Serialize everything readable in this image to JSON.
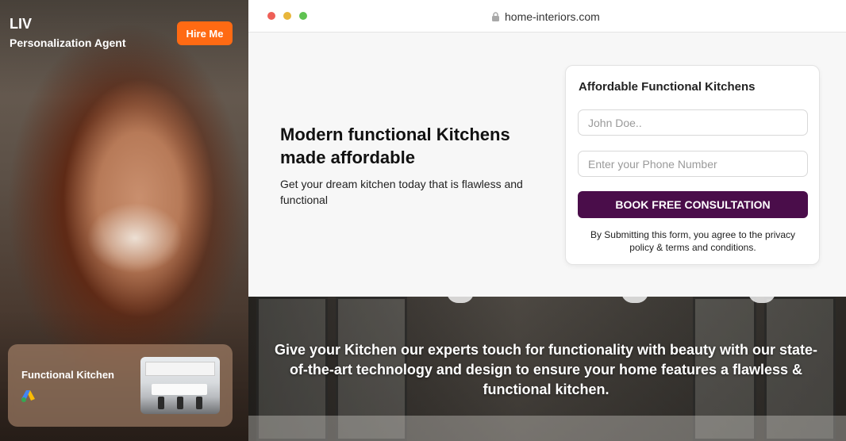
{
  "agent": {
    "name": "LIV",
    "role": "Personalization Agent",
    "hire_label": "Hire Me",
    "ad_card": {
      "title": "Functional Kitchen",
      "icon": "google-ads-icon"
    }
  },
  "browser": {
    "url": "home-interiors.com",
    "lock_icon": "lock-icon"
  },
  "hero": {
    "title": "Modern functional Kitchens made affordable",
    "subtitle": "Get your dream kitchen today that is flawless and functional"
  },
  "form": {
    "title": "Affordable Functional Kitchens",
    "name_placeholder": "John Doe..",
    "phone_placeholder": "Enter your Phone Number",
    "button_label": "BOOK FREE CONSULTATION",
    "disclaimer": "By Submitting this form, you agree to the privacy policy & terms and conditions."
  },
  "banner": {
    "text": "Give your Kitchen our experts touch for functionality with beauty with our state-of-the-art technology and design to ensure your home features a flawless & functional kitchen."
  },
  "colors": {
    "hire_button": "#ff6a13",
    "book_button": "#4a0d4a"
  }
}
